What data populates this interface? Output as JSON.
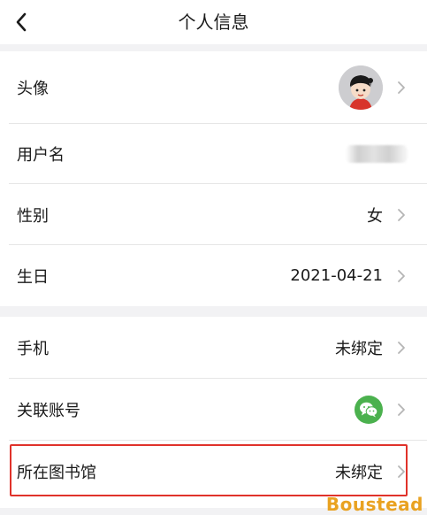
{
  "nav": {
    "title": "个人信息",
    "back_icon": "chevron-left-icon"
  },
  "profile": {
    "avatar_label": "头像",
    "username_label": "用户名",
    "username_value": "",
    "gender_label": "性别",
    "gender_value": "女",
    "birthday_label": "生日",
    "birthday_value": "2021-04-21"
  },
  "binding": {
    "phone_label": "手机",
    "phone_value": "未绑定",
    "linked_account_label": "关联账号",
    "linked_account_icon": "wechat-icon",
    "library_label": "所在图书馆",
    "library_value": "未绑定"
  },
  "watermark": "Boustead",
  "colors": {
    "highlight_border": "#e0322a",
    "wechat_green": "#4bb14e",
    "watermark": "#e9a221"
  }
}
